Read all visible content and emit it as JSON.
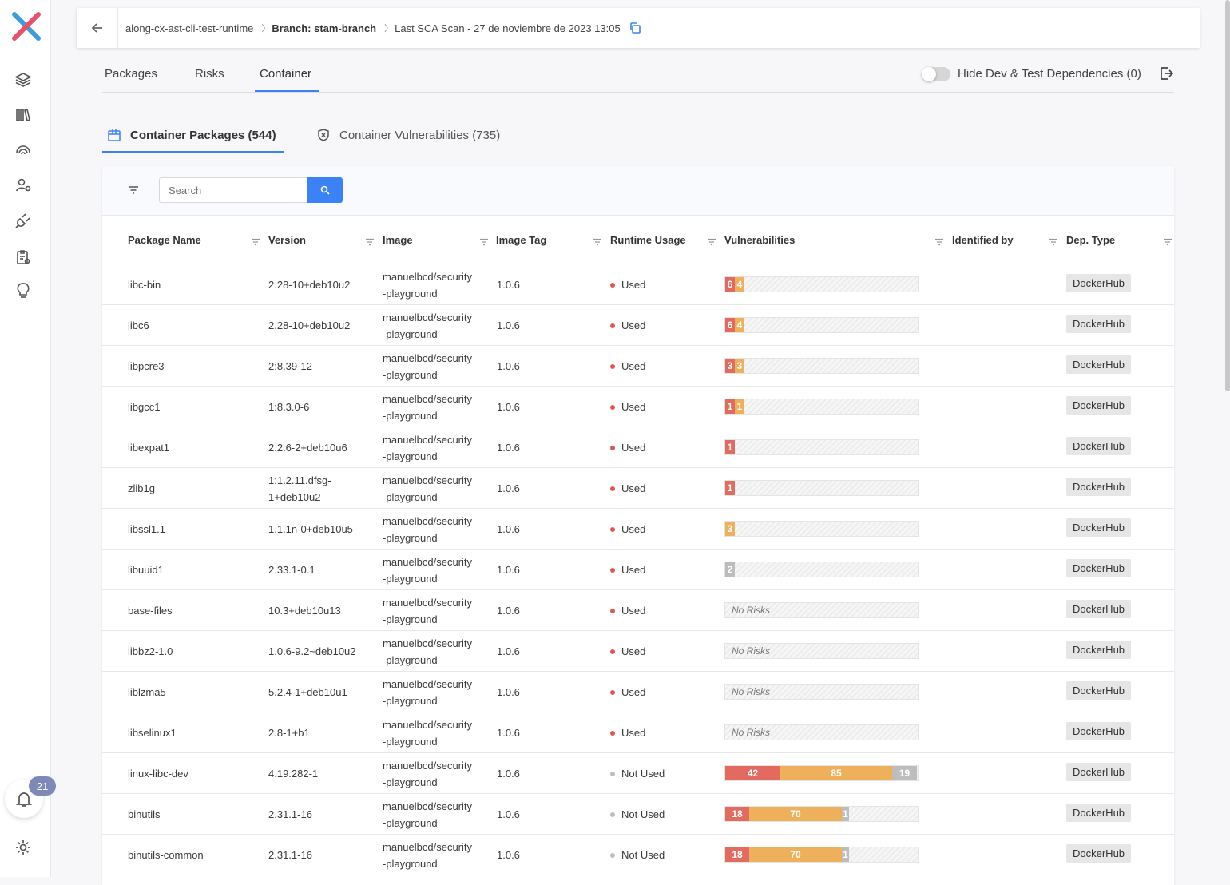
{
  "breadcrumb": {
    "project": "along-cx-ast-cli-test-runtime",
    "branch": "Branch: stam-branch",
    "scan": "Last SCA Scan - 27 de noviembre de 2023 13:05"
  },
  "tabs": [
    "Packages",
    "Risks",
    "Container"
  ],
  "hide_dev_label": "Hide Dev & Test Dependencies (0)",
  "subtabs": {
    "packages": "Container Packages (544)",
    "vulnerabilities": "Container Vulnerabilities (735)"
  },
  "search": {
    "placeholder": "Search"
  },
  "notifications": {
    "count": "21"
  },
  "colors": {
    "accent": "#3b82f6",
    "high": "#e36a5f",
    "medium": "#efb05b",
    "low": "#bdbdbd"
  },
  "columns": [
    "Package Name",
    "Version",
    "Image",
    "Image Tag",
    "Runtime Usage",
    "Vulnerabilities",
    "Identified by",
    "Dep. Type"
  ],
  "rows": [
    {
      "name": "libc-bin",
      "version": [
        "2.28-10+deb10u2"
      ],
      "image": [
        "manuelbcd/security",
        "-playground"
      ],
      "tag": "1.0.6",
      "usage": "Used",
      "vulns": [
        6,
        4,
        0
      ],
      "dep": "DockerHub"
    },
    {
      "name": "libc6",
      "version": [
        "2.28-10+deb10u2"
      ],
      "image": [
        "manuelbcd/security",
        "-playground"
      ],
      "tag": "1.0.6",
      "usage": "Used",
      "vulns": [
        6,
        4,
        0
      ],
      "dep": "DockerHub"
    },
    {
      "name": "libpcre3",
      "version": [
        "2:8.39-12"
      ],
      "image": [
        "manuelbcd/security",
        "-playground"
      ],
      "tag": "1.0.6",
      "usage": "Used",
      "vulns": [
        3,
        3,
        0
      ],
      "dep": "DockerHub"
    },
    {
      "name": "libgcc1",
      "version": [
        "1:8.3.0-6"
      ],
      "image": [
        "manuelbcd/security",
        "-playground"
      ],
      "tag": "1.0.6",
      "usage": "Used",
      "vulns": [
        1,
        1,
        0
      ],
      "dep": "DockerHub"
    },
    {
      "name": "libexpat1",
      "version": [
        "2.2.6-2+deb10u6"
      ],
      "image": [
        "manuelbcd/security",
        "-playground"
      ],
      "tag": "1.0.6",
      "usage": "Used",
      "vulns": [
        1,
        0,
        0
      ],
      "dep": "DockerHub"
    },
    {
      "name": "zlib1g",
      "version": [
        "1:1.2.11.dfsg-",
        "1+deb10u2"
      ],
      "image": [
        "manuelbcd/security",
        "-playground"
      ],
      "tag": "1.0.6",
      "usage": "Used",
      "vulns": [
        1,
        0,
        0
      ],
      "dep": "DockerHub"
    },
    {
      "name": "libssl1.1",
      "version": [
        "1.1.1n-0+deb10u5"
      ],
      "image": [
        "manuelbcd/security",
        "-playground"
      ],
      "tag": "1.0.6",
      "usage": "Used",
      "vulns": [
        0,
        3,
        0
      ],
      "dep": "DockerHub"
    },
    {
      "name": "libuuid1",
      "version": [
        "2.33.1-0.1"
      ],
      "image": [
        "manuelbcd/security",
        "-playground"
      ],
      "tag": "1.0.6",
      "usage": "Used",
      "vulns": [
        0,
        0,
        2
      ],
      "dep": "DockerHub"
    },
    {
      "name": "base-files",
      "version": [
        "10.3+deb10u13"
      ],
      "image": [
        "manuelbcd/security",
        "-playground"
      ],
      "tag": "1.0.6",
      "usage": "Used",
      "vulns": [
        0,
        0,
        0
      ],
      "dep": "DockerHub"
    },
    {
      "name": "libbz2-1.0",
      "version": [
        "1.0.6-9.2~deb10u2"
      ],
      "image": [
        "manuelbcd/security",
        "-playground"
      ],
      "tag": "1.0.6",
      "usage": "Used",
      "vulns": [
        0,
        0,
        0
      ],
      "dep": "DockerHub"
    },
    {
      "name": "liblzma5",
      "version": [
        "5.2.4-1+deb10u1"
      ],
      "image": [
        "manuelbcd/security",
        "-playground"
      ],
      "tag": "1.0.6",
      "usage": "Used",
      "vulns": [
        0,
        0,
        0
      ],
      "dep": "DockerHub"
    },
    {
      "name": "libselinux1",
      "version": [
        "2.8-1+b1"
      ],
      "image": [
        "manuelbcd/security",
        "-playground"
      ],
      "tag": "1.0.6",
      "usage": "Used",
      "vulns": [
        0,
        0,
        0
      ],
      "dep": "DockerHub"
    },
    {
      "name": "linux-libc-dev",
      "version": [
        "4.19.282-1"
      ],
      "image": [
        "manuelbcd/security",
        "-playground"
      ],
      "tag": "1.0.6",
      "usage": "Not Used",
      "vulns": [
        42,
        85,
        19
      ],
      "dep": "DockerHub"
    },
    {
      "name": "binutils",
      "version": [
        "2.31.1-16"
      ],
      "image": [
        "manuelbcd/security",
        "-playground"
      ],
      "tag": "1.0.6",
      "usage": "Not Used",
      "vulns": [
        18,
        70,
        1
      ],
      "dep": "DockerHub"
    },
    {
      "name": "binutils-common",
      "version": [
        "2.31.1-16"
      ],
      "image": [
        "manuelbcd/security",
        "-playground"
      ],
      "tag": "1.0.6",
      "usage": "Not Used",
      "vulns": [
        18,
        70,
        1
      ],
      "dep": "DockerHub"
    }
  ],
  "no_risks_label": "No Risks"
}
